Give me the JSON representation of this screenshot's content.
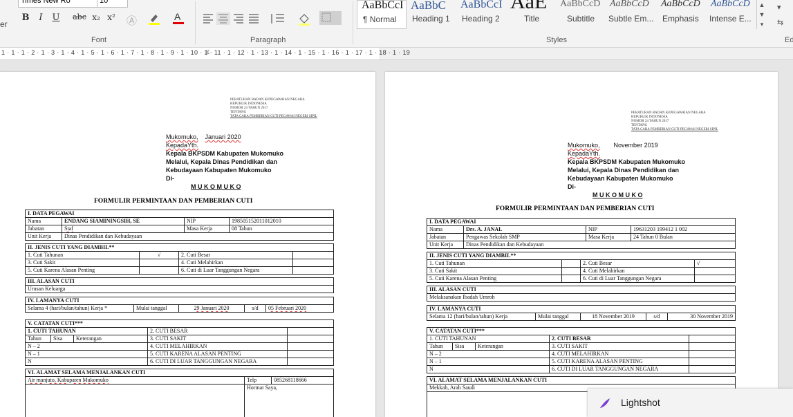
{
  "ribbon": {
    "font_name": "Times New Ro",
    "font_size": "10",
    "font_group_label": "Font",
    "paragraph_group_label": "Paragraph",
    "styles_group_label": "Styles",
    "editing_group_label": "Ed",
    "left_label": "er",
    "format_buttons": [
      "B",
      "I",
      "U",
      "abc",
      "x₂",
      "x²"
    ],
    "styles": [
      {
        "preview": "AaBbCcI",
        "name": "¶ Normal"
      },
      {
        "preview": "AaBbC",
        "name": "Heading 1"
      },
      {
        "preview": "AaBbCcI",
        "name": "Heading 2"
      },
      {
        "preview": "AaE",
        "name": "Title"
      },
      {
        "preview": "AaBbCcD",
        "name": "Subtitle"
      },
      {
        "preview": "AaBbCcD",
        "name": "Subtle Em..."
      },
      {
        "preview": "AaBbCcD",
        "name": "Emphasis"
      },
      {
        "preview": "AaBbCcD",
        "name": "Intense E..."
      }
    ]
  },
  "ruler": {
    "text": "1 · 1 · 1 · 2 · 1 · 3 · 1 · 4 · 1 · 5 · 1 · 6 · 1 · 7 · 1 · 8 · 1 · 9 · 1 · 10 · 1 · 11 · 1 · 12 · 1 · 13 · 1 · 14 · 1 · 15 · 1 · 16 · 1 · 17 · 1 · 18 · 1 · 19"
  },
  "doc_header": {
    "l1": "PERATURAN BADAN KEPEGAWAIAN NEGARA",
    "l2": "REPUBLIK INDONESIA",
    "l3": "NOMOR 24 TAHUN 2017",
    "l4": "TENTANG",
    "l5": "TATA CARA PEMBERIAN CUTI PEGAWAI NEGERI SIPIL"
  },
  "page1": {
    "place": "Mukomuko,",
    "date": "Januari 2020",
    "to1": "KepadaYth.",
    "to2": "Kepala BKPSDM Kabupaten Mukomuko",
    "to3": "Melalui, Kepala Dinas Pendidikan dan",
    "to4": "Kebudayaan Kabupaten Mukomuko",
    "to5": "Di-",
    "city": "M U K O M U K O",
    "form_title": "FORMULIR PERMINTAAN DAN PEMBERIAN CUTI",
    "s1": "I.    DATA PEGAWAI",
    "nama_l": "Nama",
    "nama": "ENDANG SIAMININGSIH, SE",
    "nip_l": "NIP",
    "nip": "198505152011012010",
    "jab_l": "Jabatan",
    "jab": "Staf",
    "mk_l": "Masa Kerja",
    "mk": "  08  Tahun",
    "uk_l": "Unit Kerja",
    "uk": "Dinas Pendidikan dan Kebudayaan",
    "s2": "II.   JENIS CUTI YANG DIAMBIL**",
    "c1": "1.   Cuti Tahunan",
    "c1m": "√",
    "c2": "2. Cuti Besar",
    "c2m": "",
    "c3": "3.   Cuti Sakit",
    "c4": "4. Cuti Melahirkan",
    "c5": "5.   Cuti Karena Alasan Penting",
    "c6": "6. Cuti di Luar Tanggungan Negara",
    "s3": "III.  ALASAN CUTI",
    "alasan": "Urusan Keluarga",
    "s4": "IV.   LAMANYA CUTI",
    "lama": "Selama    4 (hari/bulan/tahun) Kerja *",
    "mulai_l": "Mulai tanggal",
    "mulai": "29 Januari 2020",
    "sd": "s/d",
    "sampai": "05 Februari 2020",
    "s5": "V.    CATATAN CUTI***",
    "v1": "1.    CUTI TAHUNAN",
    "v2": "2.  CUTI BESAR",
    "th": "Tahun",
    "sisa": "Sisa",
    "ket": "Keterangan",
    "v3": "3.  CUTI SAKIT",
    "n2": "N – 2",
    "v4": "4.  CUTI MELAHIRKAN",
    "n1": "N – 1",
    "v5": "5.  CUTI KARENA ALASAN PENTING",
    "n": "N",
    "v6": "6.  CUTI DI LUAR TANGGUNGAN NEGARA",
    "s6": "VI.   ALAMAT SELAMA MENJALANKAN CUTI",
    "alamat": "Air manjuto, Kabupaten Mukomuko",
    "telp_l": "Telp",
    "telp": "085268118666",
    "hormat": "Hormat Saya,"
  },
  "page2": {
    "place": "Mukomuko,",
    "date": "November 2019",
    "to1": "KepadaYth.",
    "to2": "Kepala BKPSDM Kabupaten Mukomuko",
    "to3": "Melalui, Kepala Dinas Pendidikan dan",
    "to4": "Kebudayaan Kabupaten Mukomuko",
    "to5": "Di-",
    "city": "M U K O M U K O",
    "form_title": "FORMULIR PERMINTAAN DAN PEMBERIAN CUTI",
    "s1": "I.    DATA PEGAWAI",
    "nama_l": "Nama",
    "nama": "Drs. A. JANAL",
    "nip_l": "NIP",
    "nip": "19631203 199412 1 002",
    "jab_l": "Jabatan",
    "jab": "Pengawas Sekolah SMP",
    "mk_l": "Masa Kerja",
    "mk": " 24 Tahun  0 Bulan",
    "uk_l": "Unit Kerja",
    "uk": "Dinas Pendidikan dan Kebudayaan",
    "s2": "II.   JENIS CUTI YANG DIAMBIL**",
    "c1": "1.   Cuti Tahunan",
    "c1m": "",
    "c2": "2. Cuti Besar",
    "c2m": "√",
    "c3": "3.   Cuti Sakit",
    "c4": "4. Cuti Melahirkan",
    "c5": "5.   Cuti Karena Alasan Penting",
    "c6": "6. Cuti di Luar Tanggungan Negara",
    "s3": "III.  ALASAN CUTI",
    "alasan": "Melaksanakan Ibadah Umroh",
    "s4": "IV.   LAMANYA CUTI",
    "lama": "Selama   12 (hari/bulan/tahun) Kerja",
    "mulai_l": "Mulai tanggal",
    "mulai": "18 November 2019",
    "sd": "s/d",
    "sampai": "30 November 2019",
    "s5": "V.    CATATAN CUTI***",
    "v1": "1.    CUTI TAHUNAN",
    "v2": "2.  CUTI BESAR",
    "th": "Tahun",
    "sisa": "Sisa",
    "ket": "Keterangan",
    "v3": "3.  CUTI SAKIT",
    "n2": "N – 2",
    "v4": "4.  CUTI MELAHIRKAN",
    "n1": "N – 1",
    "v5": "5.  CUTI KARENA ALASAN PENTING",
    "n": "N",
    "v6": "6.  CUTI DI LUAR TANGGUNGAN NEGARA",
    "s6": "VI.   ALAMAT  SELAMA  MENJALANKAN  CUTI",
    "alamat": "Mekkah, Arab Saudi"
  },
  "toast": {
    "label": "Lightshot"
  },
  "colors": {
    "accent": "#2f5597",
    "toast_icon": "#7a3fd1",
    "spell_error": "#d33"
  }
}
